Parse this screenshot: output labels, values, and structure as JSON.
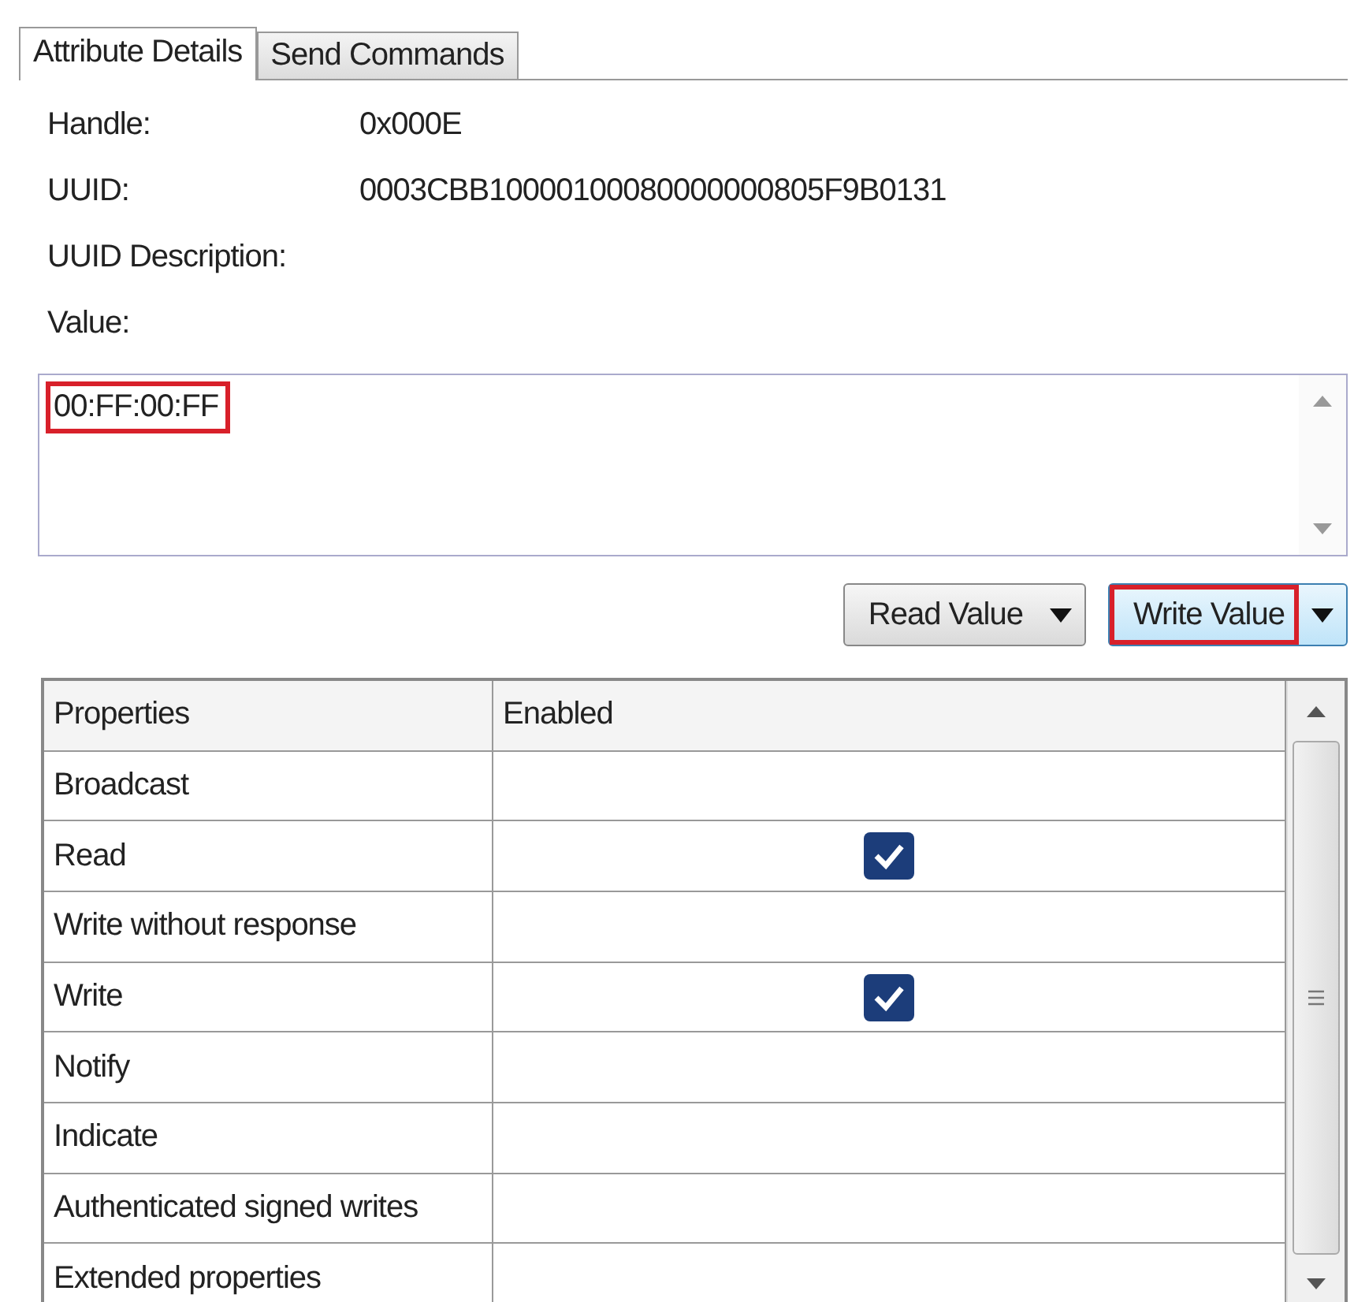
{
  "tabs": [
    {
      "label": "Attribute Details",
      "selected": true
    },
    {
      "label": "Send Commands",
      "selected": false
    }
  ],
  "details": [
    {
      "label": "Handle:",
      "value": "0x000E"
    },
    {
      "label": "UUID:",
      "value": "0003CBB10000100080000000805F9B0131"
    },
    {
      "label": "UUID Description:"
    },
    {
      "label": "Value:"
    }
  ],
  "value_box": {
    "value": "00:FF:00:FF",
    "highlighted": true
  },
  "buttons": [
    {
      "label": "Read Value",
      "hovered": false,
      "highlighted": false
    },
    {
      "label": "Write Value",
      "hovered": true,
      "highlighted": true
    }
  ],
  "table": {
    "columns": [
      "Properties",
      "Enabled"
    ],
    "rows": [
      {
        "name": "Broadcast",
        "checked": false
      },
      {
        "name": "Read",
        "checked": true
      },
      {
        "name": "Write without response",
        "checked": false
      },
      {
        "name": "Write",
        "checked": true
      },
      {
        "name": "Notify",
        "checked": false
      },
      {
        "name": "Indicate",
        "checked": false
      },
      {
        "name": "Authenticated signed writes",
        "checked": false
      },
      {
        "name": "Extended properties",
        "checked": false
      }
    ]
  }
}
